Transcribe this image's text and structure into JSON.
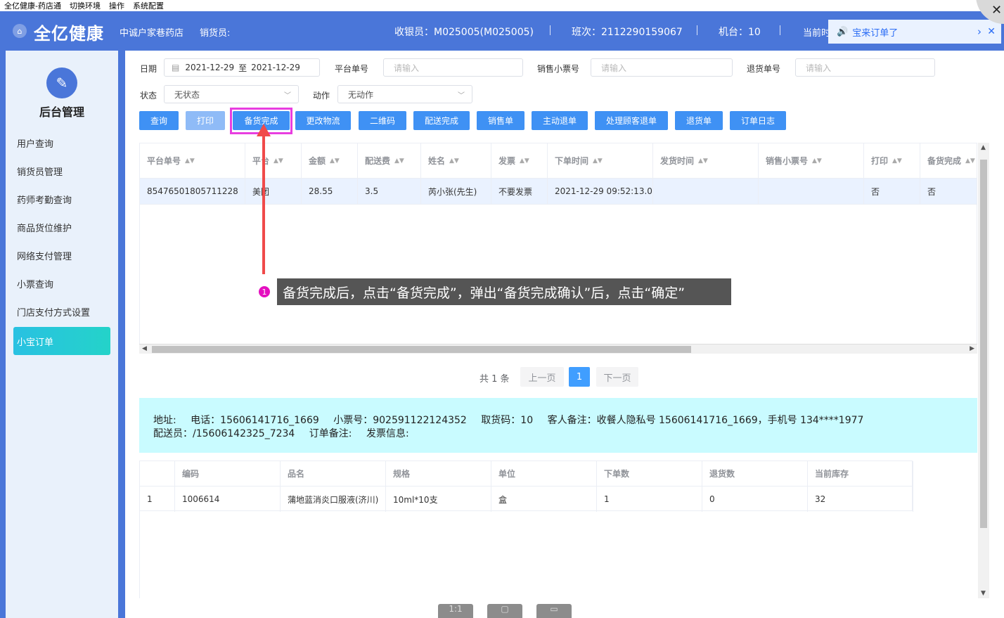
{
  "menubar": {
    "items": [
      "全亿健康-药店通",
      "切换环境",
      "操作",
      "系统配置"
    ]
  },
  "header": {
    "brand": "全亿健康",
    "store": "中诚户家巷药店",
    "seller_label": "销货员:",
    "cashier": "收银员：M025005(M025005)",
    "shift": "班次：2112290159067",
    "machine": "机台：10",
    "current": "当前时"
  },
  "notify": {
    "text": "宝来订单了",
    "chevron": "›",
    "close": "✕"
  },
  "sidebar": {
    "title": "后台管理",
    "items": [
      "用户查询",
      "销货员管理",
      "药师考勤查询",
      "商品货位维护",
      "网络支付管理",
      "小票查询",
      "门店支付方式设置",
      "小宝订单"
    ]
  },
  "filters": {
    "date_label": "日期",
    "date_from": "2021-12-29",
    "date_to_sep": "至",
    "date_to": "2021-12-29",
    "platform_no_label": "平台单号",
    "sales_ticket_label": "销售小票号",
    "return_no_label": "退货单号",
    "placeholder": "请输入",
    "status_label": "状态",
    "status_value": "无状态",
    "action_label": "动作",
    "action_value": "无动作"
  },
  "buttons": [
    "查询",
    "打印",
    "备货完成",
    "更改物流",
    "二维码",
    "配送完成",
    "销售单",
    "主动退单",
    "处理顾客退单",
    "退货单",
    "订单日志"
  ],
  "orders": {
    "columns": [
      "平台单号",
      "平台",
      "金额",
      "配送费",
      "姓名",
      "发票",
      "下单时间",
      "发货时间",
      "销售小票号",
      "打印",
      "备货完成"
    ],
    "rows": [
      [
        "85476501805711228",
        "美团",
        "28.55",
        "3.5",
        "芮小张(先生)",
        "不要发票",
        "2021-12-29 09:52:13.0",
        "",
        "",
        "否",
        "否"
      ]
    ]
  },
  "pagination": {
    "total": "共 1 条",
    "prev": "上一页",
    "page": "1",
    "next": "下一页"
  },
  "info": {
    "address": "地址:",
    "phone": "电话：15606141716_1669",
    "ticket": "小票号：902591122124352",
    "pickup": "取货码：10",
    "remark": "客人备注：收餐人隐私号 15606141716_1669，手机号 134****1977",
    "courier": "配送员：/15606142325_7234",
    "order_remark": "订单备注:",
    "invoice": "发票信息:"
  },
  "items": {
    "columns": [
      "",
      "编码",
      "品名",
      "规格",
      "单位",
      "下单数",
      "退货数",
      "当前库存"
    ],
    "rows": [
      [
        "1",
        "1006614",
        "蒲地蓝消炎口服液(济川)",
        "10ml*10支",
        "盒",
        "1",
        "0",
        "32"
      ]
    ]
  },
  "annotation": {
    "number": "1",
    "text": "备货完成后，点击“备货完成”，弹出“备货完成确认”后，点击“确定”"
  },
  "bottom_toolbar": {
    "label": "1:1"
  },
  "colors": {
    "primary": "#4a76d9",
    "button": "#3f91f4",
    "active": "#29c1e2",
    "highlight": "#e83ee0",
    "arrow": "#f04a4a"
  }
}
